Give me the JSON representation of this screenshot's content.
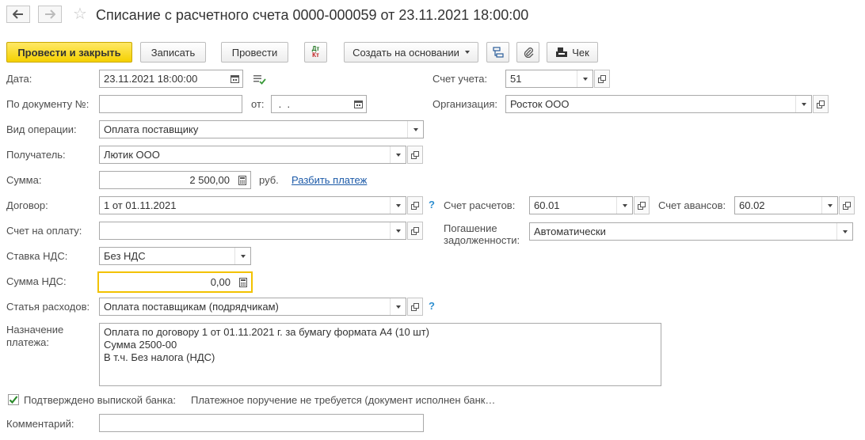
{
  "header": {
    "title": "Списание с расчетного счета 0000-000059 от 23.11.2021 18:00:00"
  },
  "toolbar": {
    "post_close": "Провести и закрыть",
    "save": "Записать",
    "post": "Провести",
    "dt_kt_top": "Дт",
    "dt_kt_bottom": "Кт",
    "create_based": "Создать на основании",
    "receipt": "Чек"
  },
  "form": {
    "date_label": "Дата:",
    "date_value": "23.11.2021 18:00:00",
    "doc_no_label": "По документу №:",
    "doc_no_value": "",
    "from_label": "от:",
    "from_value": " .  .",
    "operation_label": "Вид операции:",
    "operation_value": "Оплата поставщику",
    "recipient_label": "Получатель:",
    "recipient_value": "Лютик ООО",
    "amount_label": "Сумма:",
    "amount_value": "2 500,00",
    "currency": "руб.",
    "split_link": "Разбить платеж",
    "contract_label": "Договор:",
    "contract_value": "1 от 01.11.2021",
    "invoice_label": "Счет на оплату:",
    "invoice_value": "",
    "vat_rate_label": "Ставка НДС:",
    "vat_rate_value": "Без НДС",
    "vat_amount_label": "Сумма НДС:",
    "vat_amount_value": "0,00",
    "expense_label": "Статья расходов:",
    "expense_value": "Оплата поставщикам (подрядчикам)",
    "purpose_label_1": "Назначение",
    "purpose_label_2": "платежа:",
    "purpose_lines": [
      "Оплата по договору 1 от 01.11.2021 г.  за бумагу формата А4 (10 шт)",
      "Сумма 2500-00",
      "В т.ч. Без налога (НДС)"
    ],
    "bank_confirmed_label": "Подтверждено выпиской банка:",
    "bank_confirmed_checked": true,
    "bank_note": "Платежное поручение не требуется (документ исполнен банк…",
    "comment_label": "Комментарий:",
    "comment_value": "",
    "account_label": "Счет учета:",
    "account_value": "51",
    "org_label": "Организация:",
    "org_value": "Росток ООО",
    "settlement_label": "Счет расчетов:",
    "settlement_value": "60.01",
    "advance_label": "Счет авансов:",
    "advance_value": "60.02",
    "debt_label_1": "Погашение",
    "debt_label_2": "задолженности:",
    "debt_value": "Автоматически",
    "question_mark": "?"
  },
  "colors": {
    "primary_button": "#f5d100",
    "link": "#1c5aa8",
    "help": "#2f8fd0",
    "focus_border": "#f2c200"
  }
}
